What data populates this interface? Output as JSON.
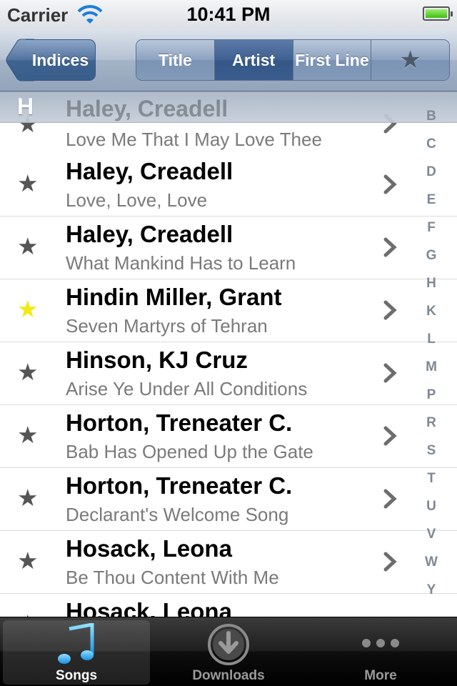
{
  "status": {
    "carrier": "Carrier",
    "time": "10:41 PM"
  },
  "nav": {
    "back_label": "Indices",
    "segments": [
      {
        "label": "Title",
        "active": false
      },
      {
        "label": "Artist",
        "active": true
      },
      {
        "label": "First Line",
        "active": false
      },
      {
        "label": "★",
        "active": false
      }
    ]
  },
  "section": {
    "letter": "H",
    "ghost_title": "Haley, Creadell"
  },
  "rows": [
    {
      "title": "",
      "subtitle": "Love Me That I May Love Thee",
      "favorite": false
    },
    {
      "title": "Haley, Creadell",
      "subtitle": "Love, Love, Love",
      "favorite": false
    },
    {
      "title": "Haley, Creadell",
      "subtitle": "What Mankind Has to Learn",
      "favorite": false
    },
    {
      "title": "Hindin Miller, Grant",
      "subtitle": "Seven Martyrs of Tehran",
      "favorite": true
    },
    {
      "title": "Hinson, KJ Cruz",
      "subtitle": "Arise Ye Under All Conditions",
      "favorite": false
    },
    {
      "title": "Horton, Treneater C.",
      "subtitle": "Bab Has Opened Up the Gate",
      "favorite": false
    },
    {
      "title": "Horton, Treneater C.",
      "subtitle": "Declarant's Welcome Song",
      "favorite": false
    },
    {
      "title": "Hosack, Leona",
      "subtitle": "Be Thou Content With Me",
      "favorite": false
    },
    {
      "title": "Hosack, Leona",
      "subtitle": "",
      "favorite": false
    }
  ],
  "index_letters": [
    "B",
    "C",
    "D",
    "E",
    "F",
    "G",
    "H",
    "K",
    "L",
    "M",
    "P",
    "R",
    "S",
    "T",
    "U",
    "V",
    "W",
    "Y"
  ],
  "tabs": [
    {
      "label": "Songs",
      "icon": "music-note-icon",
      "active": true
    },
    {
      "label": "Downloads",
      "icon": "download-icon",
      "active": false
    },
    {
      "label": "More",
      "icon": "more-dots-icon",
      "active": false
    }
  ],
  "colors": {
    "nav_active": "#3e6192",
    "favorite_star": "#f2ea14",
    "star": "#555555"
  }
}
